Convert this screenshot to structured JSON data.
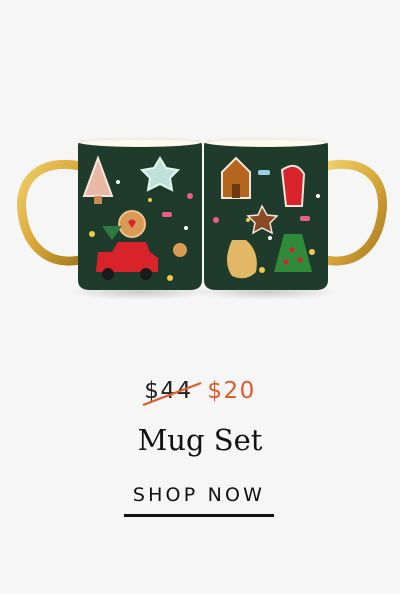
{
  "product": {
    "old_price": "$44",
    "new_price": "$20",
    "title": "Mug Set",
    "cta_label": "SHOP NOW",
    "image_description": "Two dark green mugs with gold handles decorated with holiday cookie illustrations"
  },
  "colors": {
    "background": "#f6f6f6",
    "sale_price": "#e05a2b",
    "strike_line": "#e05a2b",
    "text": "#111111",
    "mug_body": "#1e3b2b",
    "mug_handle": "#d9a83a"
  }
}
